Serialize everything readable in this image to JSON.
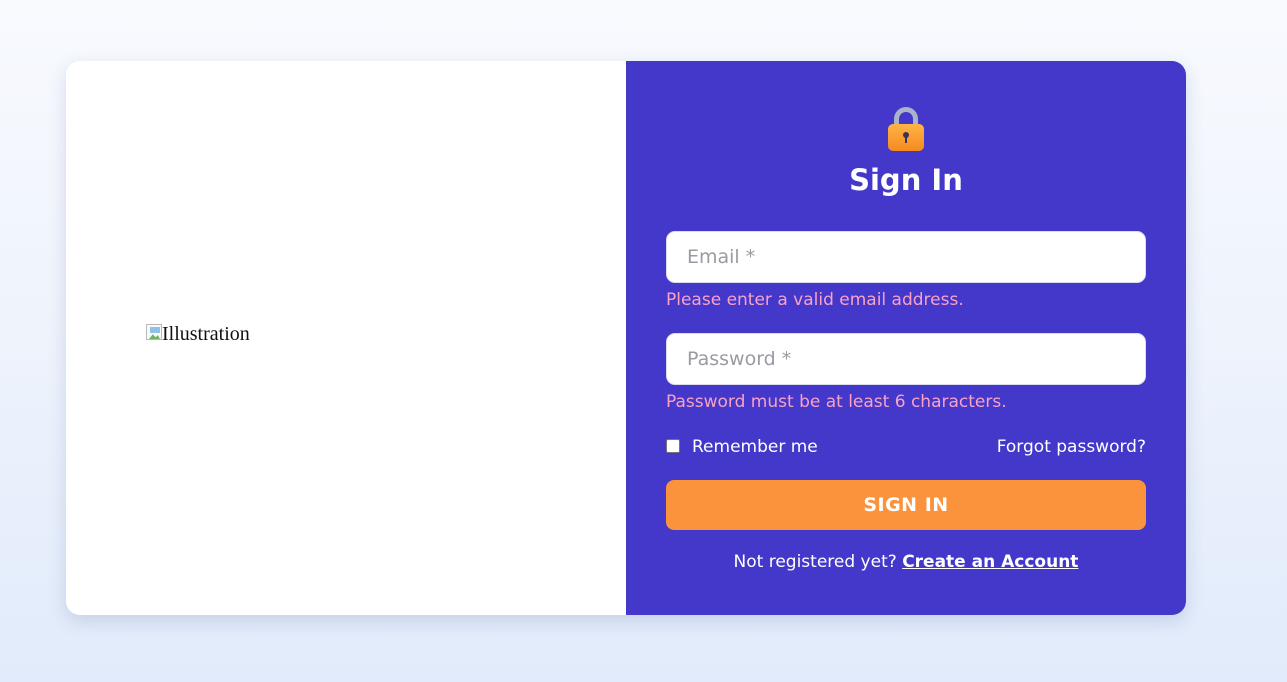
{
  "left": {
    "image_alt": "Illustration"
  },
  "form": {
    "lock_icon": "lock-icon",
    "title": "Sign In",
    "email": {
      "placeholder": "Email *",
      "value": "",
      "error": "Please enter a valid email address."
    },
    "password": {
      "placeholder": "Password *",
      "value": "",
      "error": "Password must be at least 6 characters."
    },
    "remember_label": "Remember me",
    "remember_checked": false,
    "forgot_label": "Forgot password?",
    "submit_label": "SIGN IN",
    "register_prompt": "Not registered yet?",
    "register_link": "Create an Account"
  },
  "colors": {
    "panel": "#4338ca",
    "button": "#fb923c",
    "error": "#fba1c5"
  }
}
